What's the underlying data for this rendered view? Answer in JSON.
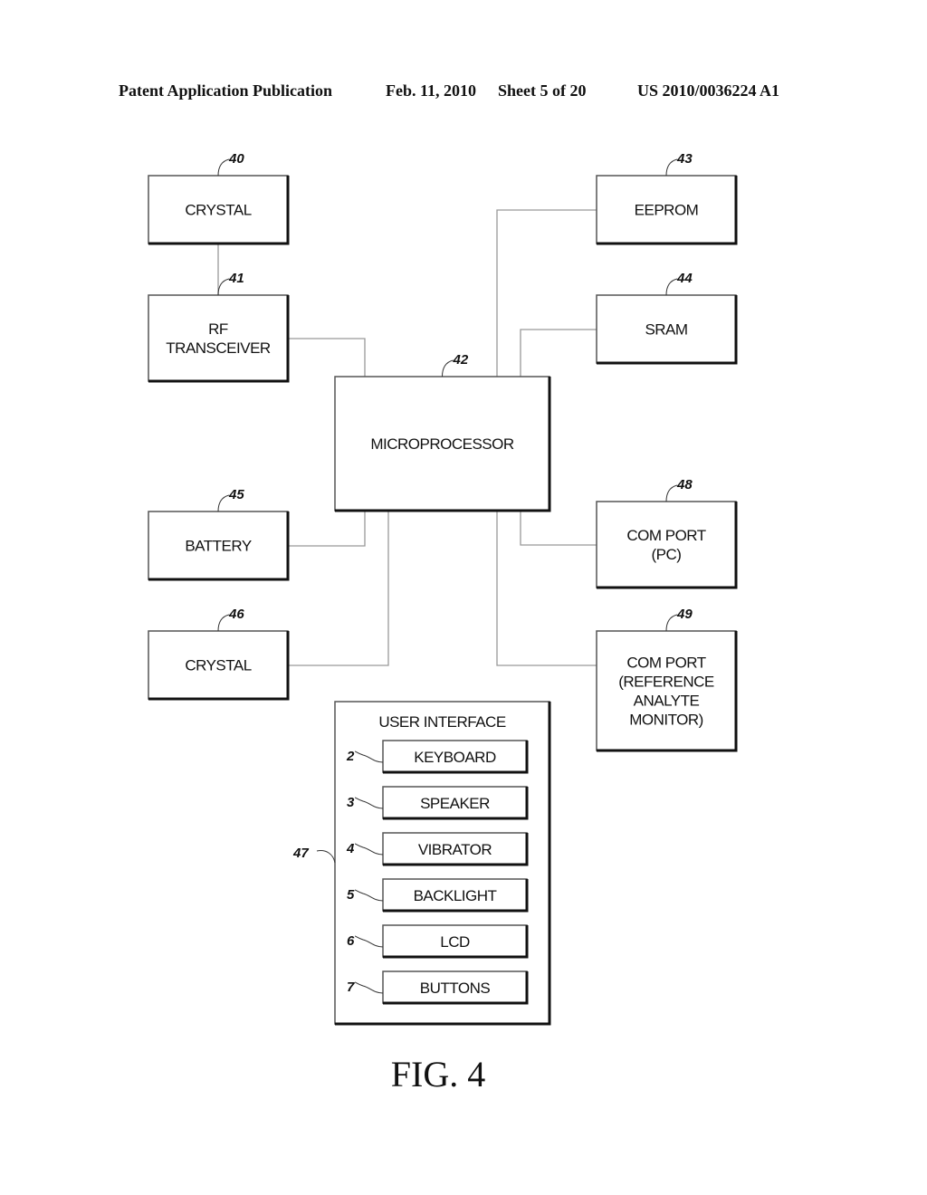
{
  "header": {
    "publication": "Patent Application Publication",
    "date": "Feb. 11, 2010",
    "sheet": "Sheet 5 of 20",
    "number": "US 2010/0036224 A1"
  },
  "figure_label": "FIG. 4",
  "blocks": {
    "crystal_40": {
      "ref": "40",
      "lines": [
        "CRYSTAL"
      ]
    },
    "rf_41": {
      "ref": "41",
      "lines": [
        "RF",
        "TRANSCEIVER"
      ]
    },
    "micro_42": {
      "ref": "42",
      "lines": [
        "MICROPROCESSOR"
      ]
    },
    "eeprom_43": {
      "ref": "43",
      "lines": [
        "EEPROM"
      ]
    },
    "sram_44": {
      "ref": "44",
      "lines": [
        "SRAM"
      ]
    },
    "battery_45": {
      "ref": "45",
      "lines": [
        "BATTERY"
      ]
    },
    "crystal_46": {
      "ref": "46",
      "lines": [
        "CRYSTAL"
      ]
    },
    "ui_47": {
      "ref": "47",
      "lines": [
        "USER INTERFACE"
      ]
    },
    "com_48": {
      "ref": "48",
      "lines": [
        "COM PORT",
        "(PC)"
      ]
    },
    "com_49": {
      "ref": "49",
      "lines": [
        "COM PORT",
        "(REFERENCE",
        "ANALYTE",
        "MONITOR)"
      ]
    }
  },
  "ui_items": [
    {
      "ref": "2",
      "label": "KEYBOARD"
    },
    {
      "ref": "3",
      "label": "SPEAKER"
    },
    {
      "ref": "4",
      "label": "VIBRATOR"
    },
    {
      "ref": "5",
      "label": "BACKLIGHT"
    },
    {
      "ref": "6",
      "label": "LCD"
    },
    {
      "ref": "7",
      "label": "BUTTONS"
    }
  ],
  "connections": [
    [
      "crystal_40",
      "rf_41"
    ],
    [
      "rf_41",
      "micro_42"
    ],
    [
      "eeprom_43",
      "micro_42"
    ],
    [
      "sram_44",
      "micro_42"
    ],
    [
      "battery_45",
      "micro_42"
    ],
    [
      "crystal_46",
      "micro_42"
    ],
    [
      "com_48",
      "micro_42"
    ],
    [
      "com_49",
      "micro_42"
    ]
  ]
}
